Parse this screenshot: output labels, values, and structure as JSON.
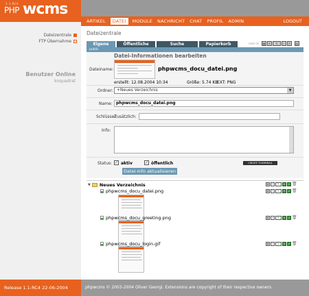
{
  "header": {
    "logo_small": "1.1-RC4",
    "logo_php": "PHP",
    "logo_wcms": "wcms"
  },
  "nav": {
    "items": [
      "ARTIKEL",
      "DATEI",
      "MODULE",
      "NACHRICHT",
      "CHAT",
      "PROFIL",
      "ADMIN"
    ],
    "active": "DATEI",
    "logout": "LOGOUT"
  },
  "sidebar": {
    "items": [
      {
        "label": "Dateizentrale",
        "active": true
      },
      {
        "label": "FTP Übernahme",
        "active": false
      }
    ],
    "online_title": "Benutzer Online",
    "online_user": "knquadrat"
  },
  "page": {
    "title": "Dateizentrale",
    "tabs": [
      "Eigene",
      "Öffentliche",
      "Suche",
      "Papierkorb"
    ],
    "active_tab": "Eigene",
    "tab_tools_label": "next ok",
    "section_label": "public"
  },
  "form": {
    "heading": "Datei-Informationen bearbeiten",
    "filename_label": "Dateiname:",
    "filename": "phpwcms_docu_datei.png",
    "created": "erstellt: 12.08.2004 10:34",
    "size": "Größe: 5.74 KB",
    "ext": "EXT: PNG",
    "folder_label": "Ordner:",
    "folder_value": "+Neues Verzeichnis",
    "name_label": "Name:",
    "name_value": "phpwcms_docu_datei.png",
    "keyword_label": "Schlüssel:",
    "additional_label": "Zusätzlich:",
    "info_label": "Info:",
    "status_label": "Status:",
    "status_active": "aktiv",
    "status_public": "öffentlich",
    "thumbnail_button": "CREATE THUMBNAIL",
    "save_button": "Datei-Info aktualisieren"
  },
  "list": {
    "folder_name": "Neues Verzeichnis",
    "files": [
      {
        "name": "phpwcms_docu_datei.png"
      },
      {
        "name": "phpwcms_docu_greeting.png"
      },
      {
        "name": "phpwcms_docu_login.gif"
      }
    ]
  },
  "footer": {
    "release": "Release 1.1-RC4 22-06-2004",
    "copyright": "phpwcms © 2003-2004 Oliver Georgi. Extensions are copyright of their respective owners."
  },
  "colors": {
    "accent": "#e8611e",
    "tab_dark": "#3e5866",
    "tab_light": "#6b98b3",
    "footer_grey": "#999999"
  }
}
